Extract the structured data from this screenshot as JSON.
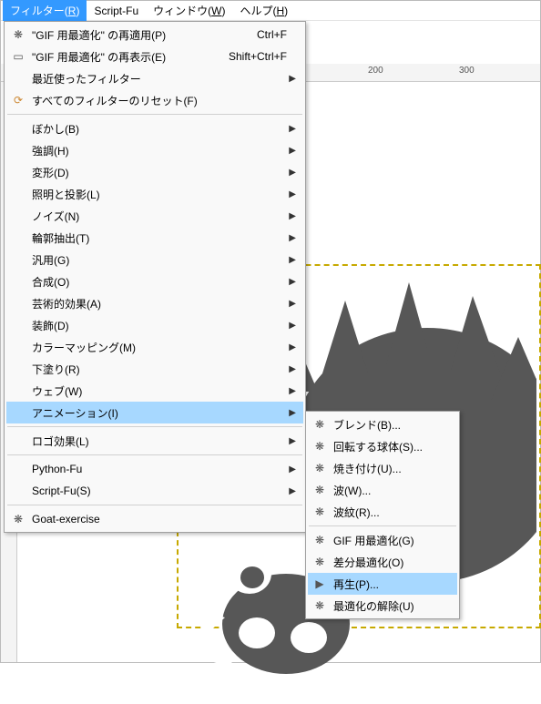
{
  "menubar": {
    "filters": {
      "label": "フィルター(R)",
      "mnemonic": "R"
    },
    "scriptfu": {
      "label": "Script-Fu"
    },
    "window": {
      "label": "ウィンドウ(W)",
      "mnemonic": "W"
    },
    "help": {
      "label": "ヘルプ(H)",
      "mnemonic": "H"
    }
  },
  "filters_menu": {
    "repeat": {
      "label": "\"GIF 用最適化\" の再適用(P)",
      "accel": "Ctrl+F"
    },
    "reshow": {
      "label": "\"GIF 用最適化\" の再表示(E)",
      "accel": "Shift+Ctrl+F"
    },
    "recent": {
      "label": "最近使ったフィルター"
    },
    "reset": {
      "label": "すべてのフィルターのリセット(F)"
    },
    "blur": {
      "label": "ぼかし(B)"
    },
    "enhance": {
      "label": "強調(H)"
    },
    "distort": {
      "label": "変形(D)"
    },
    "light": {
      "label": "照明と投影(L)"
    },
    "noise": {
      "label": "ノイズ(N)"
    },
    "edge": {
      "label": "輪郭抽出(T)"
    },
    "generic": {
      "label": "汎用(G)"
    },
    "combine": {
      "label": "合成(O)"
    },
    "artistic": {
      "label": "芸術的効果(A)"
    },
    "decor": {
      "label": "装飾(D)"
    },
    "colormap": {
      "label": "カラーマッピング(M)"
    },
    "render": {
      "label": "下塗り(R)"
    },
    "web": {
      "label": "ウェブ(W)"
    },
    "anim": {
      "label": "アニメーション(I)"
    },
    "logo": {
      "label": "ロゴ効果(L)"
    },
    "python": {
      "label": "Python-Fu"
    },
    "script": {
      "label": "Script-Fu(S)"
    },
    "goat": {
      "label": "Goat-exercise"
    }
  },
  "anim_menu": {
    "blend": {
      "label": "ブレンド(B)..."
    },
    "globe": {
      "label": "回転する球体(S)..."
    },
    "burn": {
      "label": "焼き付け(U)..."
    },
    "wave": {
      "label": "波(W)..."
    },
    "ripple": {
      "label": "波紋(R)..."
    },
    "gifopt": {
      "label": "GIF 用最適化(G)"
    },
    "diffopt": {
      "label": "差分最適化(O)"
    },
    "playback": {
      "label": "再生(P)..."
    },
    "unopt": {
      "label": "最適化の解除(U)"
    }
  },
  "ruler": {
    "t200": "200",
    "t300": "300"
  }
}
